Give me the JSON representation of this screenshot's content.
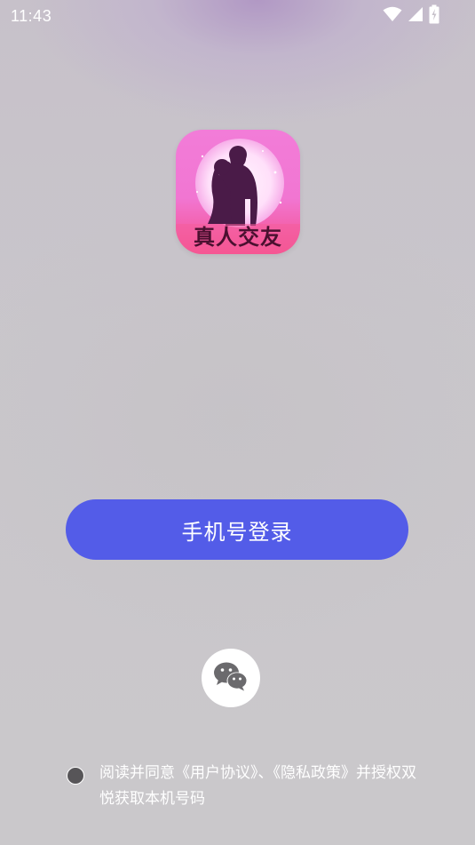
{
  "status_bar": {
    "time": "11:43",
    "icons": [
      "wifi-icon",
      "cellular-signal-icon",
      "battery-charging-icon"
    ]
  },
  "app": {
    "logo_text": "真人交友",
    "logo_colors": {
      "top": "#f27cd8",
      "bottom": "#f54f8a",
      "moon": "#ffe6fb",
      "silhouette": "#4a1b48"
    }
  },
  "login": {
    "phone_button_label": "手机号登录",
    "wechat_icon": "wechat-icon",
    "accent_color": "#535ce8"
  },
  "agreement": {
    "prefix": "阅读并同意",
    "user_agreement": "《用户协议》",
    "separator": "、",
    "privacy_policy": "《隐私政策》",
    "suffix": "并授权双悦获取本机号码"
  }
}
